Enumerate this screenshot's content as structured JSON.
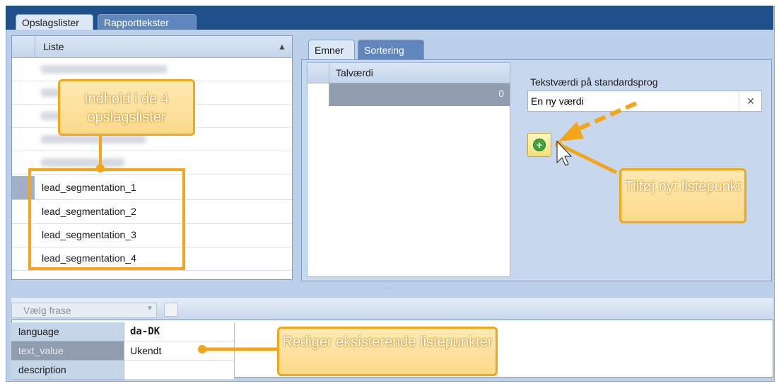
{
  "tabs": [
    {
      "label": "Opslagslister",
      "active": true
    },
    {
      "label": "Rapporttekster",
      "active": false
    }
  ],
  "list_panel": {
    "column_header": "Liste",
    "items": [
      "lead_segmentation_1",
      "lead_segmentation_2",
      "lead_segmentation_3",
      "lead_segmentation_4"
    ]
  },
  "detail_tabs": [
    {
      "label": "Emner",
      "active": true
    },
    {
      "label": "Sortering",
      "active": false
    }
  ],
  "value_grid": {
    "column_header": "Talværdi",
    "rows": [
      "0"
    ]
  },
  "text_value": {
    "label": "Tekstværdi på standardsprog",
    "value": "En ny værdi",
    "clear_glyph": "✕"
  },
  "add_button": {
    "icon": "plus-circle-icon",
    "glyph": "+"
  },
  "toolbar": {
    "phrase_placeholder": "Vælg frase",
    "dropdown_glyph": "▼"
  },
  "properties": [
    {
      "key": "language",
      "value": "da-DK"
    },
    {
      "key": "text_value",
      "value": "Ukendt"
    },
    {
      "key": "description",
      "value": ""
    }
  ],
  "callouts": {
    "list_contents": "Indhold i de 4 opslagslister",
    "add_item": "Tilføj nyt listepunkt",
    "edit_items": "Rediger eksisterende listepunkter"
  },
  "colors": {
    "accent": "#f5a51a",
    "header": "#1f5089",
    "panel": "#c6d7ee"
  }
}
